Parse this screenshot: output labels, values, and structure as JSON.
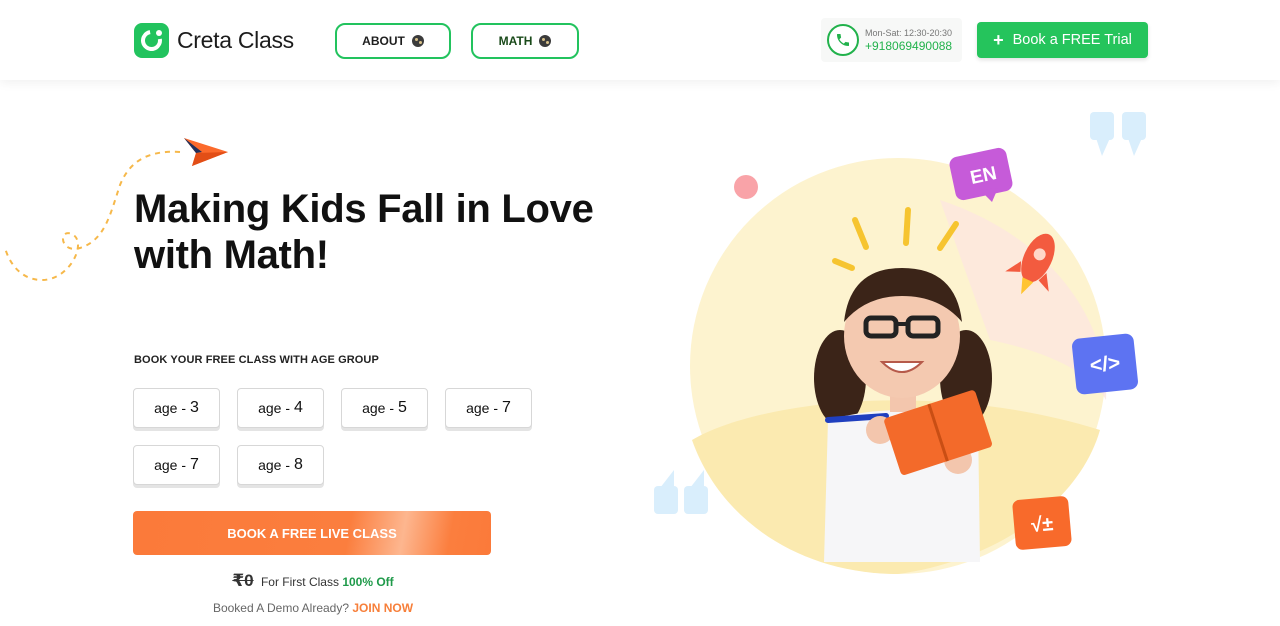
{
  "brand": {
    "name": "Creta Class"
  },
  "nav": {
    "about": "ABOUT",
    "math": "MATH"
  },
  "contact": {
    "hours": "Mon-Sat: 12:30-20:30",
    "phone": "+918069490088"
  },
  "header": {
    "trial_label": "Book a FREE Trial"
  },
  "hero": {
    "title_line1": "Making Kids Fall in Love",
    "title_line2": "with Math!",
    "age_heading": "BOOK YOUR FREE CLASS WITH AGE GROUP",
    "age_prefix": "age -",
    "ages": [
      "3",
      "4",
      "5",
      "7",
      "7",
      "8"
    ],
    "cta": "BOOK A FREE LIVE CLASS",
    "price_symbol": "₹0",
    "price_text": "For First Class",
    "price_off": "100% Off",
    "demo_text": "Booked A Demo Already?",
    "join_label": "JOIN NOW"
  },
  "illustration": {
    "bubble_en": "EN",
    "code_icon": "</>",
    "math_icon": "√±"
  },
  "colors": {
    "brand_green": "#22c35e",
    "cta_orange": "#fb7a3a",
    "price_green": "#1f9a4a",
    "join_orange": "#f77f3a"
  }
}
